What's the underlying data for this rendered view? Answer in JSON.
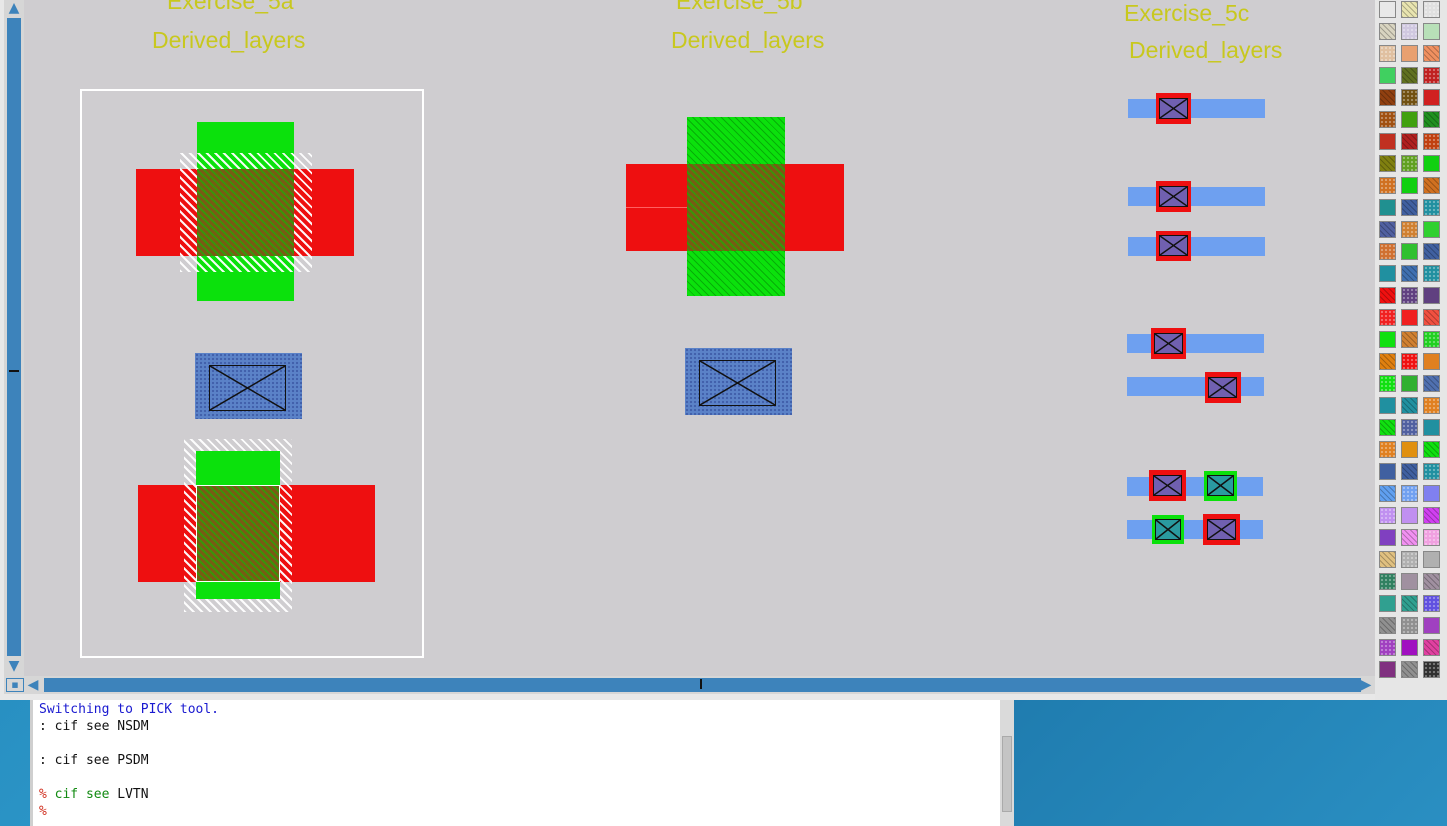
{
  "colors": {
    "red": "#ee0f10",
    "green": "#0be10c",
    "blue": "#6ea0f0",
    "label": "#c8c81e",
    "canvas": "#cfcdd0"
  },
  "icons": {
    "scroll_up": "arrow-up-icon",
    "scroll_down": "arrow-down-icon",
    "scroll_left": "arrow-left-icon",
    "scroll_right": "arrow-right-icon",
    "corner": "zoom-box-icon"
  },
  "layout_labels": {
    "ex5a_title": "Exercise_5a",
    "ex5a_sub": "Derived_layers",
    "ex5b_title": "Exercise_5b",
    "ex5b_sub": "Derived_layers",
    "ex5c_title": "Exercise_5c",
    "ex5c_sub": "Derived_layers"
  },
  "console": {
    "lines": [
      {
        "prompt": "",
        "text": "Switching to PICK tool.",
        "kind": "info"
      },
      {
        "prompt": ":",
        "text": " cif see NSDM",
        "kind": "cmd"
      },
      {
        "prompt": "",
        "text": "",
        "kind": "blank"
      },
      {
        "prompt": ":",
        "text": " cif see PSDM",
        "kind": "cmd"
      },
      {
        "prompt": "",
        "text": "",
        "kind": "blank"
      },
      {
        "prompt": "%",
        "text": " cif see",
        "arg": " LVTN",
        "kind": "tcl"
      },
      {
        "prompt": "%",
        "text": "",
        "kind": "prompt"
      }
    ]
  },
  "palette": {
    "rows": [
      [
        "#e8e8e8",
        "#e8e4b0",
        "#e0e0e0"
      ],
      [
        "#d8d4c0",
        "#d0c8e0",
        "#b8e0b8"
      ],
      [
        "#e0c0a0",
        "#e8a070",
        "#f09060"
      ],
      [
        "#40d060",
        "#607020",
        "#c02020"
      ],
      [
        "#904010",
        "#705010",
        "#d02020"
      ],
      [
        "#a05010",
        "#40a010",
        "#209020"
      ],
      [
        "#c03020",
        "#b02020",
        "#c04010"
      ],
      [
        "#808010",
        "#60a020",
        "#10d010"
      ],
      [
        "#d07020",
        "#10d010",
        "#d07020"
      ],
      [
        "#209090",
        "#4060a0",
        "#2090a0"
      ],
      [
        "#5060a0",
        "#d08030",
        "#30d030"
      ],
      [
        "#d07030",
        "#30c030",
        "#4060a0"
      ],
      [
        "#2090a0",
        "#4070b0",
        "#2090a0"
      ],
      [
        "#f01010",
        "#604080",
        "#604080"
      ],
      [
        "#f02020",
        "#f02020",
        "#f05040"
      ],
      [
        "#10e010",
        "#d08030",
        "#20d020"
      ],
      [
        "#e08010",
        "#f01010",
        "#e08020"
      ],
      [
        "#10e010",
        "#30b030",
        "#5070b0"
      ],
      [
        "#2090a0",
        "#2090a0",
        "#e08020"
      ],
      [
        "#10e010",
        "#5060a0",
        "#2090a0"
      ],
      [
        "#e08020",
        "#e09010",
        "#10e010"
      ],
      [
        "#4060a0",
        "#4060a0",
        "#2090a0"
      ],
      [
        "#60a0f0",
        "#70a0f0",
        "#8080f0"
      ],
      [
        "#c090f0",
        "#c090f0",
        "#d040f0"
      ],
      [
        "#8040c0",
        "#f090f0",
        "#f0a0e0"
      ],
      [
        "#e0c080",
        "#b0b0b0",
        "#b0b0b0"
      ],
      [
        "#308060",
        "#a090a0",
        "#a090a0"
      ],
      [
        "#30a090",
        "#30a090",
        "#6050e0"
      ],
      [
        "#909090",
        "#909090",
        "#a040c0"
      ],
      [
        "#a040c0",
        "#a010c0",
        "#e040a0"
      ],
      [
        "#803080",
        "#909090",
        "#303030"
      ]
    ]
  }
}
